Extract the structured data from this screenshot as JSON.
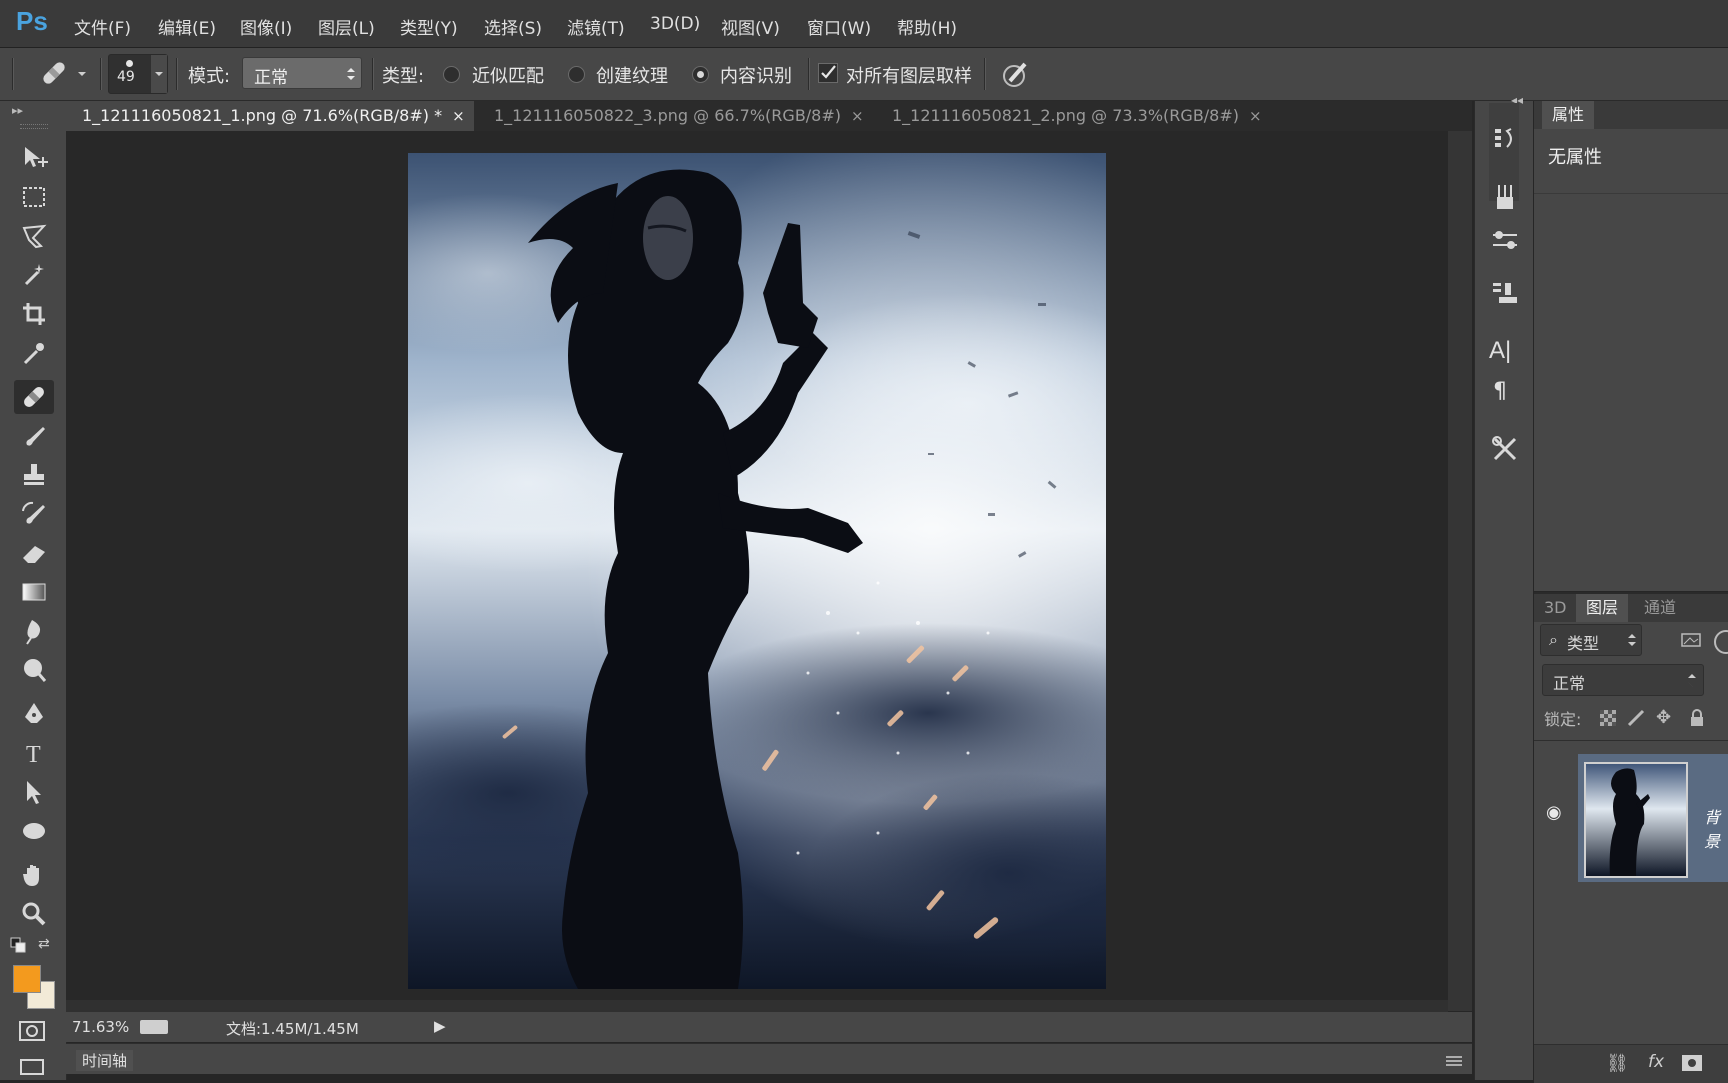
{
  "app": {
    "logo": "Ps"
  },
  "menu": [
    "文件(F)",
    "编辑(E)",
    "图像(I)",
    "图层(L)",
    "类型(Y)",
    "选择(S)",
    "滤镜(T)",
    "3D(D)",
    "视图(V)",
    "窗口(W)",
    "帮助(H)"
  ],
  "options": {
    "brush_size": "49",
    "mode_label": "模式:",
    "mode_value": "正常",
    "type_label": "类型:",
    "radio_proximity": "近似匹配",
    "radio_texture": "创建纹理",
    "radio_content_aware": "内容识别",
    "sample_all_layers": "对所有图层取样",
    "selected_type": "内容识别",
    "sample_all_checked": true
  },
  "tabs": [
    {
      "label": "1_121116050821_1.png @ 71.6%(RGB/8#) *",
      "close": "×",
      "active": true
    },
    {
      "label": "1_121116050822_3.png @ 66.7%(RGB/8#)",
      "close": "×",
      "active": false
    },
    {
      "label": "1_121116050821_2.png @ 73.3%(RGB/8#)",
      "close": "×",
      "active": false
    }
  ],
  "tools": [
    "move-tool",
    "marquee-tool",
    "lasso-tool",
    "magic-wand-tool",
    "crop-tool",
    "eyedropper-tool",
    "spot-healing-brush-tool",
    "brush-tool",
    "clone-stamp-tool",
    "history-brush-tool",
    "eraser-tool",
    "gradient-tool",
    "blur-tool",
    "dodge-tool",
    "pen-tool",
    "type-tool",
    "path-selection-tool",
    "ellipse-tool",
    "hand-tool",
    "zoom-tool"
  ],
  "colors": {
    "foreground": "#f39a1e",
    "background": "#f2ead7",
    "accent_blue": "#4aa3df"
  },
  "status": {
    "zoom": "71.63%",
    "doc_label": "文档:1.45M/1.45M",
    "play": "▶"
  },
  "timeline": {
    "label": "时间轴"
  },
  "dock": {
    "collapse": "◂◂"
  },
  "properties": {
    "tab": "属性",
    "content": "无属性"
  },
  "layers_panel": {
    "tabs": [
      "3D",
      "图层",
      "通道"
    ],
    "active_tab": "图层",
    "filter_label": "类型",
    "blend_mode": "正常",
    "lock_label": "锁定:",
    "layer_name": "背景",
    "footer_icons": [
      "link-icon",
      "fx-icon",
      "mask-icon"
    ],
    "footer_fx": "fx"
  }
}
